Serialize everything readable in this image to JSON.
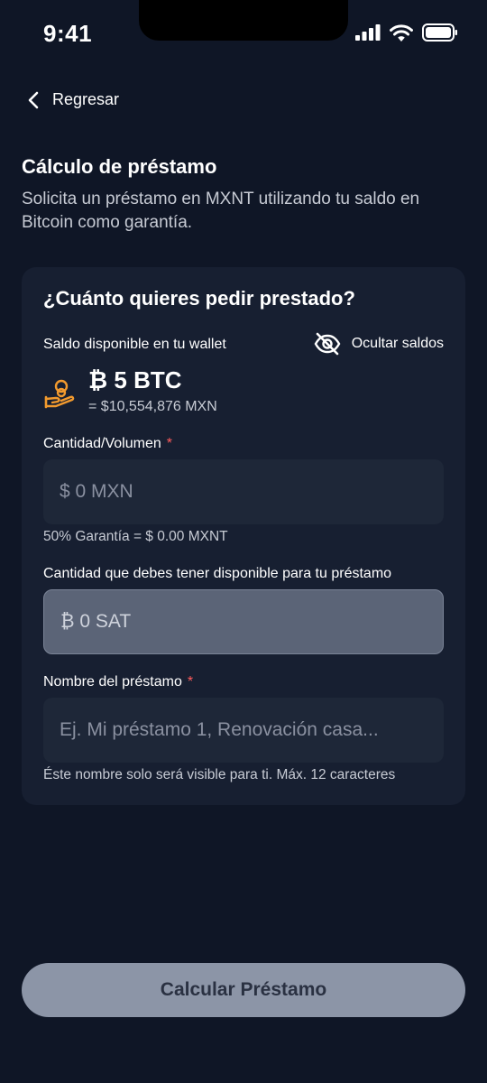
{
  "status_bar": {
    "time": "9:41"
  },
  "nav": {
    "back_label": "Regresar"
  },
  "header": {
    "title": "Cálculo de préstamo",
    "subtitle": "Solicita un préstamo en MXNT utilizando tu saldo en Bitcoin como garantía."
  },
  "card": {
    "title": "¿Cuánto quieres pedir prestado?",
    "balance_label": "Saldo disponible en tu wallet",
    "hide_label": "Ocultar saldos",
    "balance_btc": "₿ 5 BTC",
    "balance_mxn": "= $10,554,876 MXN",
    "amount": {
      "label": "Cantidad/Volumen",
      "required_mark": "*",
      "placeholder": "$ 0 MXN",
      "value": "",
      "hint": "50% Garantía = $ 0.00 MXNT"
    },
    "collateral": {
      "label": "Cantidad que debes tener disponible para tu préstamo",
      "placeholder": "₿ 0 SAT"
    },
    "loan_name": {
      "label": "Nombre del préstamo",
      "required_mark": "*",
      "placeholder": "Ej. Mi préstamo 1, Renovación casa...",
      "value": "",
      "hint": "Éste nombre solo será visible para ti. Máx. 12 caracteres"
    }
  },
  "actions": {
    "calculate_label": "Calcular Préstamo"
  },
  "colors": {
    "background": "#0f1626",
    "card": "#171f31",
    "accent_orange": "#f29a2e",
    "required_red": "#ff5c5c",
    "button_disabled": "#8c95a7"
  },
  "icons": {
    "back": "chevron-left-icon",
    "hide": "eye-off-icon",
    "balance": "hand-coins-icon",
    "signal": "signal-icon",
    "wifi": "wifi-icon",
    "battery": "battery-icon"
  }
}
